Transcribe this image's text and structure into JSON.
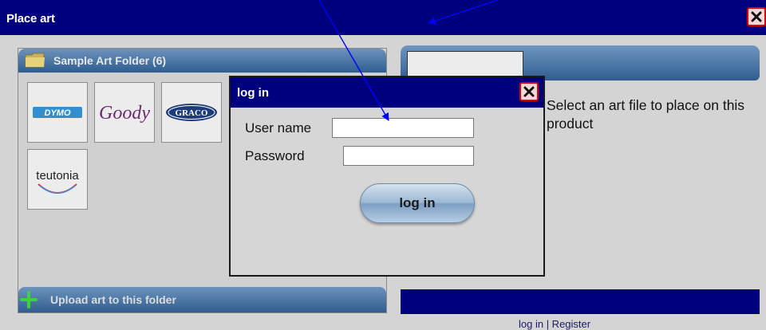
{
  "window": {
    "title": "Place art"
  },
  "left_panel": {
    "folder_label": "Sample Art Folder (6)",
    "thumbnails": [
      "DYMO",
      "Goody",
      "GRACO",
      "teutonia"
    ],
    "upload_label": "Upload art to this folder"
  },
  "right_panel": {
    "message": "Select an art file to place on this product",
    "links": "log in | Register"
  },
  "login_dialog": {
    "title": "log in",
    "username_label": "User name",
    "username_value": "",
    "password_label": "Password",
    "password_value": "",
    "button_label": "log in"
  },
  "icons": {
    "close": "close-icon",
    "folder": "folder-icon",
    "upload": "plus-icon"
  },
  "colors": {
    "titlebar": "#00007f",
    "panel_header": "#2f5d8f",
    "close_border": "#e00000"
  }
}
